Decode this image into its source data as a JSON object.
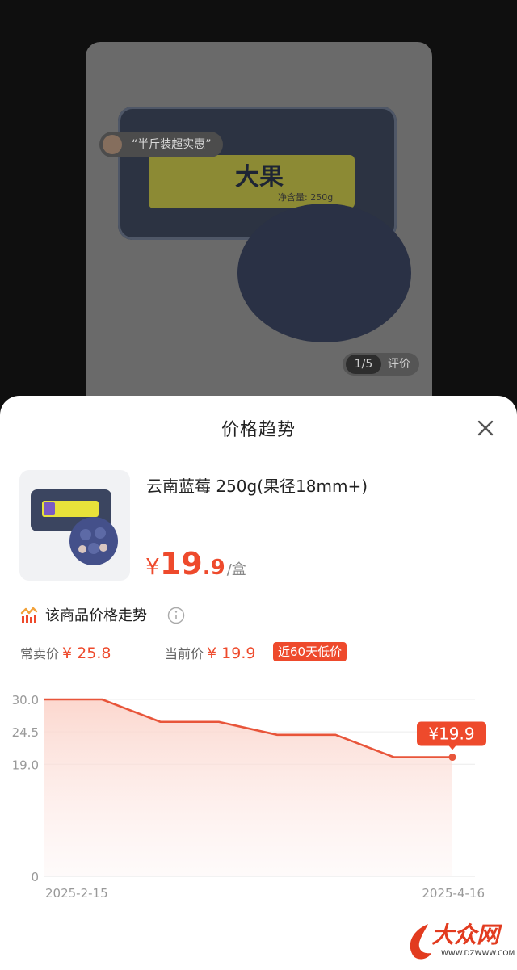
{
  "background": {
    "chip_text": "“半斤装超实惠”",
    "package_label": "大果",
    "package_weight": "净含量: 250g",
    "pager": "1/5",
    "review_label": "评价"
  },
  "sheet": {
    "title": "价格趋势",
    "product": {
      "name": "云南蓝莓 250g(果径18mm+)",
      "price_symbol": "¥",
      "price_int": "19",
      "price_dec": ".9",
      "price_unit": "/盒"
    },
    "trend_title": "该商品价格走势",
    "regular_price_label": "常卖价",
    "regular_price_value": "¥ 25.8",
    "current_price_label": "当前价",
    "current_price_value": "¥ 19.9",
    "low_badge": "近60天低价"
  },
  "chart_data": {
    "type": "line",
    "x": [
      "2025-2-15",
      "2025-2-21",
      "2025-3-3",
      "2025-3-13",
      "2025-3-23",
      "2025-4-2",
      "2025-4-12",
      "2025-4-16"
    ],
    "values": [
      30.0,
      30.0,
      26.2,
      26.2,
      24.0,
      24.0,
      20.2,
      20.2
    ],
    "xtick_labels": [
      "2025-2-15",
      "2025-4-16"
    ],
    "yticks": [
      "0",
      "19.0",
      "24.5",
      "30.0"
    ],
    "ylim": [
      0,
      30
    ],
    "current_label": "¥19.9",
    "line_color": "#e8553a",
    "fill_color": "#fde3dc",
    "grid": true
  },
  "colors": {
    "accent": "#ee4a2c"
  },
  "watermark": {
    "text": "大众网",
    "url": "WWW.DZWWW.COM"
  }
}
